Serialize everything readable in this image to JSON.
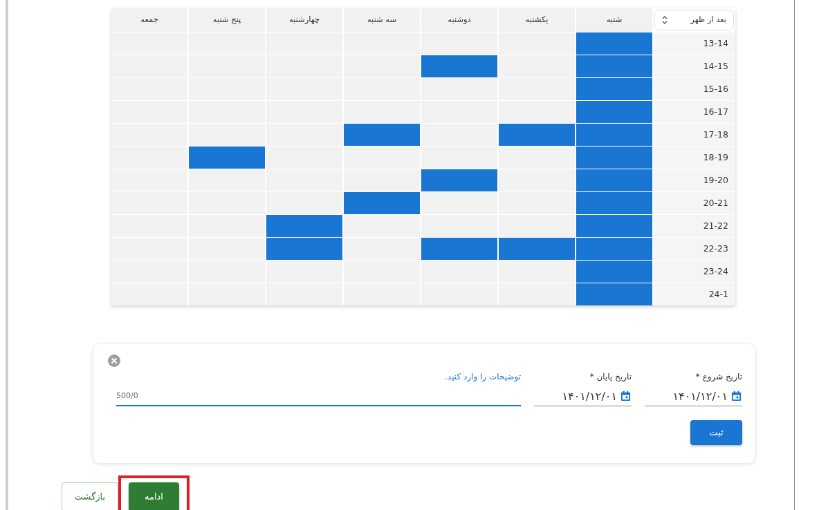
{
  "schedule": {
    "period_selector": {
      "value": "بعد از ظهر"
    },
    "days": [
      "شنبه",
      "یکشنبه",
      "دوشنبه",
      "سه شنبه",
      "چهارشنبه",
      "پنج شنبه",
      "جمعه"
    ],
    "rows": [
      {
        "time": "13-14",
        "cells": [
          true,
          false,
          false,
          false,
          false,
          false,
          false
        ]
      },
      {
        "time": "14-15",
        "cells": [
          true,
          false,
          true,
          false,
          false,
          false,
          false
        ]
      },
      {
        "time": "15-16",
        "cells": [
          true,
          false,
          false,
          false,
          false,
          false,
          false
        ]
      },
      {
        "time": "16-17",
        "cells": [
          true,
          false,
          false,
          false,
          false,
          false,
          false
        ]
      },
      {
        "time": "17-18",
        "cells": [
          true,
          true,
          false,
          true,
          false,
          false,
          false
        ]
      },
      {
        "time": "18-19",
        "cells": [
          true,
          false,
          false,
          false,
          false,
          true,
          false
        ]
      },
      {
        "time": "19-20",
        "cells": [
          true,
          false,
          true,
          false,
          false,
          false,
          false
        ]
      },
      {
        "time": "20-21",
        "cells": [
          true,
          false,
          false,
          true,
          false,
          false,
          false
        ]
      },
      {
        "time": "21-22",
        "cells": [
          true,
          false,
          false,
          false,
          true,
          false,
          false
        ]
      },
      {
        "time": "22-23",
        "cells": [
          true,
          true,
          true,
          false,
          true,
          false,
          false
        ]
      },
      {
        "time": "23-24",
        "cells": [
          true,
          false,
          false,
          false,
          false,
          false,
          false
        ]
      },
      {
        "time": "24-1",
        "cells": [
          true,
          false,
          false,
          false,
          false,
          false,
          false
        ]
      }
    ]
  },
  "form": {
    "fields": [
      {
        "kind": "date",
        "label": "تاریخ شروع *",
        "value": "۱۴۰۱/۱۲/۰۱"
      },
      {
        "kind": "date",
        "label": "تاریخ پایان *",
        "value": "۱۴۰۱/۱۲/۰۱"
      },
      {
        "kind": "text",
        "label": "توضیحات را وارد کنید.",
        "counter": "500/0",
        "focused": true
      }
    ],
    "submit": "ثبت"
  },
  "buttons": [
    {
      "label": "ادامه",
      "kind": "primary",
      "highlighted": true
    },
    {
      "label": "بازگشت",
      "kind": "outline",
      "highlighted": false
    }
  ]
}
